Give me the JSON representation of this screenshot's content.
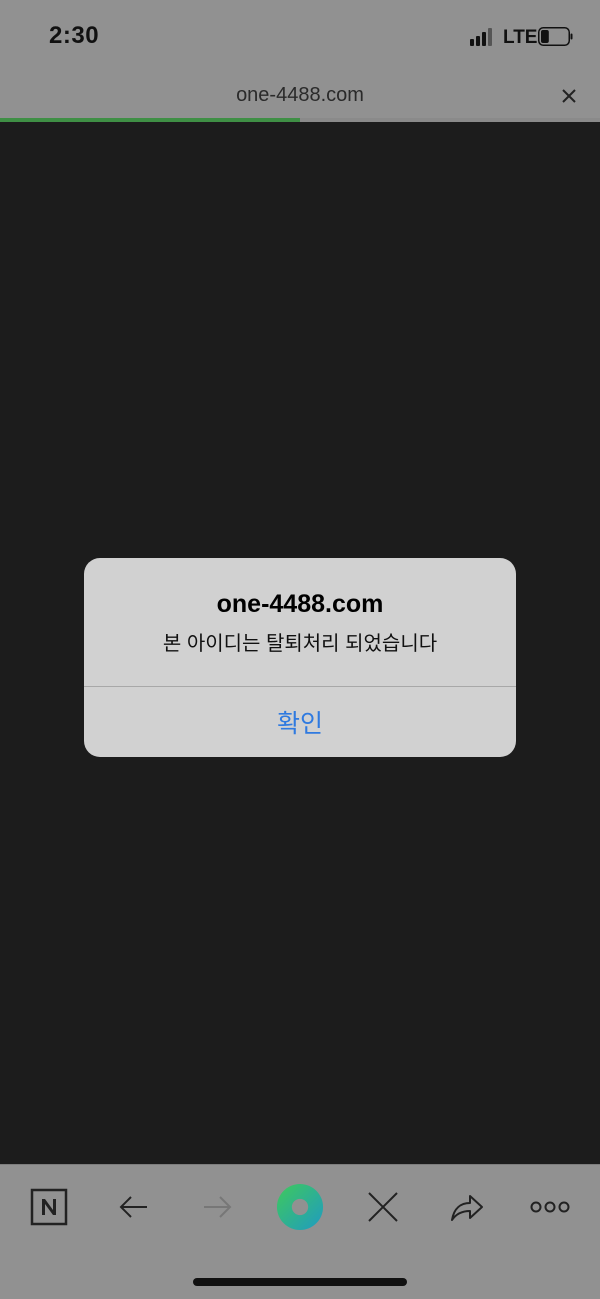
{
  "status_bar": {
    "time": "2:30",
    "network": "LTE",
    "signal_bars": 4,
    "battery_level": 0.3
  },
  "browser": {
    "url": "one-4488.com",
    "load_progress": 0.5,
    "progress_color": "#3f8f45"
  },
  "alert": {
    "title": "one-4488.com",
    "message": "본 아이디는 탈퇴처리 되었습니다",
    "confirm_label": "확인",
    "button_color": "#2f7ae0"
  },
  "toolbar": {
    "items": [
      {
        "icon": "naver-n-icon"
      },
      {
        "icon": "back-arrow-icon"
      },
      {
        "icon": "forward-arrow-icon"
      },
      {
        "icon": "green-dot-icon"
      },
      {
        "icon": "close-x-icon"
      },
      {
        "icon": "share-arrow-icon"
      },
      {
        "icon": "more-dots-icon"
      }
    ]
  }
}
